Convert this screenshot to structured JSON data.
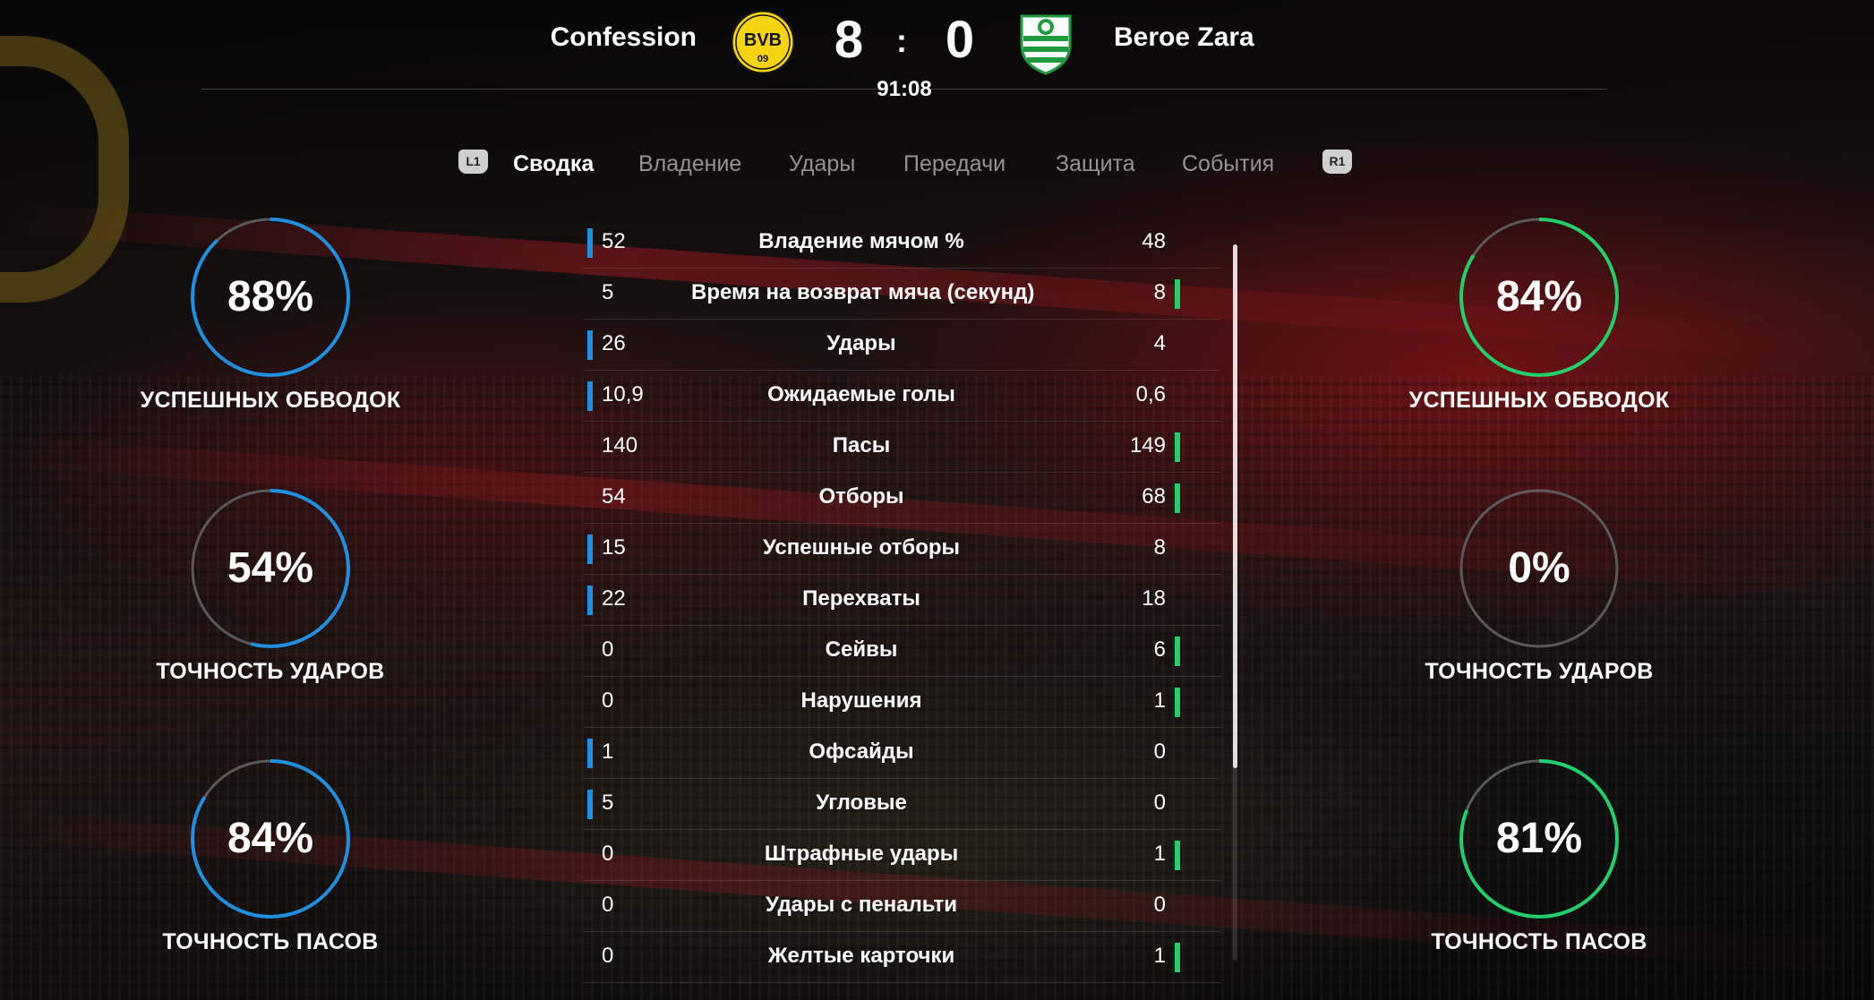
{
  "colors": {
    "home_accent": "#1f8fe0",
    "away_accent": "#22d06a",
    "ring_track": "#5a5a5a",
    "home_crest_yellow": "#f5d40f",
    "away_crest_green": "#1f9a3e"
  },
  "match": {
    "home_team": "Confession",
    "away_team": "Beroe Zara",
    "home_score": "8",
    "separator": ":",
    "away_score": "0",
    "clock": "91:08",
    "home_crest_icon": "bvb-crest-icon",
    "away_crest_icon": "beroe-crest-icon",
    "home_crest_text": "BVB",
    "home_crest_sub": "09"
  },
  "tabs": {
    "left_bumper": "L1",
    "right_bumper": "R1",
    "items": [
      {
        "label": "Сводка",
        "active": true
      },
      {
        "label": "Владение",
        "active": false
      },
      {
        "label": "Удары",
        "active": false
      },
      {
        "label": "Передачи",
        "active": false
      },
      {
        "label": "Защита",
        "active": false
      },
      {
        "label": "События",
        "active": false
      }
    ]
  },
  "home_rings": [
    {
      "value": "88%",
      "fraction": 0.88,
      "label": "УСПЕШНЫХ ОБВОДОК"
    },
    {
      "value": "54%",
      "fraction": 0.54,
      "label": "ТОЧНОСТЬ УДАРОВ"
    },
    {
      "value": "84%",
      "fraction": 0.84,
      "label": "ТОЧНОСТЬ ПАСОВ"
    }
  ],
  "away_rings": [
    {
      "value": "84%",
      "fraction": 0.84,
      "label": "УСПЕШНЫХ ОБВОДОК"
    },
    {
      "value": "0%",
      "fraction": 0.0,
      "label": "ТОЧНОСТЬ УДАРОВ"
    },
    {
      "value": "81%",
      "fraction": 0.81,
      "label": "ТОЧНОСТЬ ПАСОВ"
    }
  ],
  "stats": [
    {
      "home": "52",
      "label": "Владение мячом %",
      "away": "48",
      "leader": "home"
    },
    {
      "home": "5",
      "label": "Время на возврат мяча (секунд)",
      "away": "8",
      "leader": "away"
    },
    {
      "home": "26",
      "label": "Удары",
      "away": "4",
      "leader": "home"
    },
    {
      "home": "10,9",
      "label": "Ожидаемые голы",
      "away": "0,6",
      "leader": "home"
    },
    {
      "home": "140",
      "label": "Пасы",
      "away": "149",
      "leader": "away"
    },
    {
      "home": "54",
      "label": "Отборы",
      "away": "68",
      "leader": "away"
    },
    {
      "home": "15",
      "label": "Успешные отборы",
      "away": "8",
      "leader": "home"
    },
    {
      "home": "22",
      "label": "Перехваты",
      "away": "18",
      "leader": "home"
    },
    {
      "home": "0",
      "label": "Сейвы",
      "away": "6",
      "leader": "away"
    },
    {
      "home": "0",
      "label": "Нарушения",
      "away": "1",
      "leader": "away"
    },
    {
      "home": "1",
      "label": "Офсайды",
      "away": "0",
      "leader": "home"
    },
    {
      "home": "5",
      "label": "Угловые",
      "away": "0",
      "leader": "home"
    },
    {
      "home": "0",
      "label": "Штрафные удары",
      "away": "1",
      "leader": "away"
    },
    {
      "home": "0",
      "label": "Удары с пенальти",
      "away": "0",
      "leader": "none"
    },
    {
      "home": "0",
      "label": "Желтые карточки",
      "away": "1",
      "leader": "away"
    }
  ]
}
